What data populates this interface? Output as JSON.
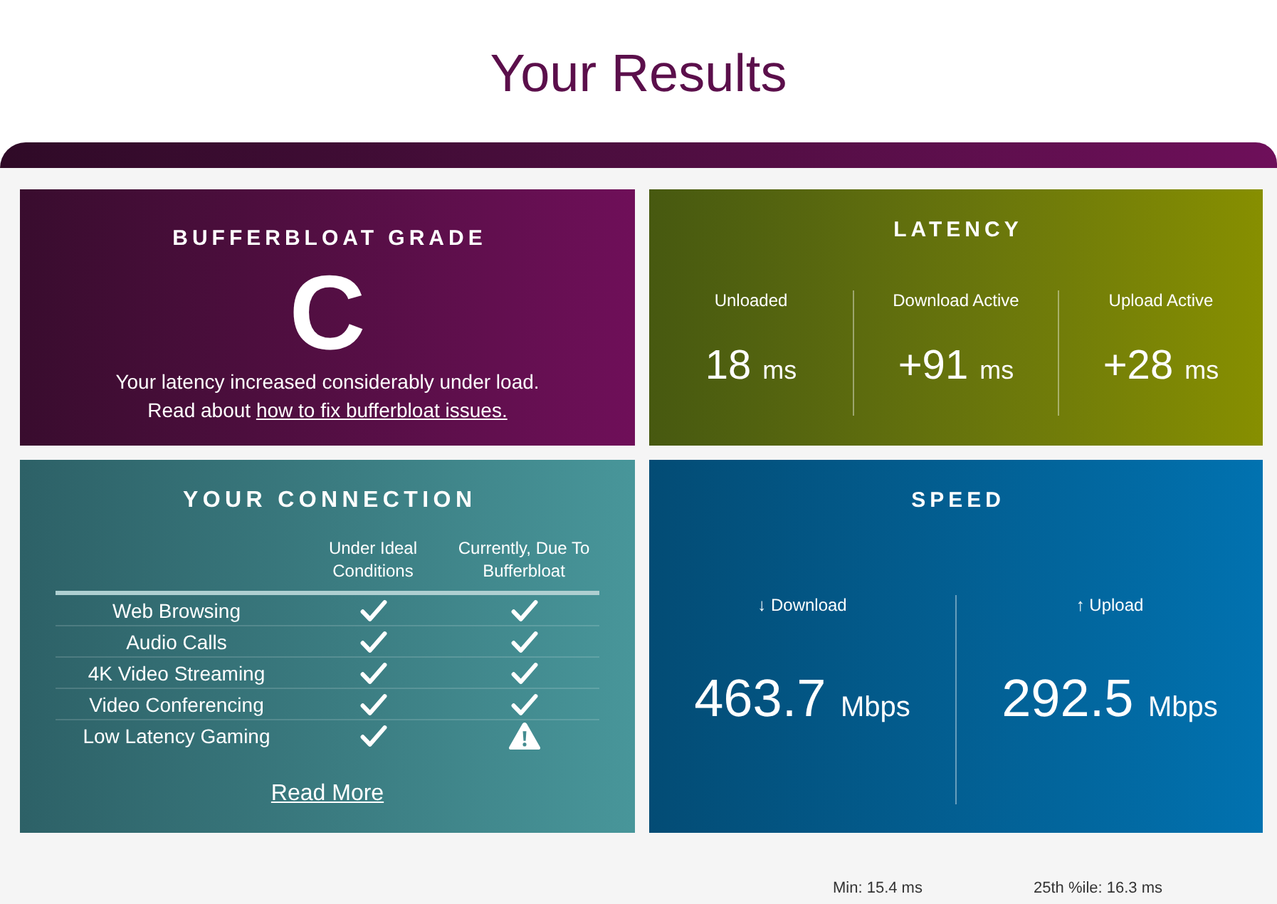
{
  "page": {
    "title": "Your Results"
  },
  "grade": {
    "title": "BUFFERBLOAT GRADE",
    "grade": "C",
    "description": "Your latency increased considerably under load.",
    "link_intro": "Read about",
    "link": "how to fix bufferbloat issues."
  },
  "latency": {
    "title": "LATENCY",
    "items": [
      {
        "label": "Unloaded",
        "value": "18",
        "unit": "ms"
      },
      {
        "label": "Download Active",
        "value": "+91",
        "unit": "ms"
      },
      {
        "label": "Upload Active",
        "value": "+28",
        "unit": "ms"
      }
    ]
  },
  "connection": {
    "title": "YOUR CONNECTION",
    "columns": [
      "Under Ideal Conditions",
      "Currently, Due To Bufferbloat"
    ],
    "rows": [
      {
        "name": "Web Browsing",
        "ideal_ok": true,
        "current_ok": true
      },
      {
        "name": "Audio Calls",
        "ideal_ok": true,
        "current_ok": true
      },
      {
        "name": "4K Video Streaming",
        "ideal_ok": true,
        "current_ok": true
      },
      {
        "name": "Video Conferencing",
        "ideal_ok": true,
        "current_ok": true
      },
      {
        "name": "Low Latency Gaming",
        "ideal_ok": true,
        "current_ok": false
      }
    ],
    "link": "Read More"
  },
  "speed": {
    "title": "SPEED",
    "items": [
      {
        "label": "↓ Download",
        "value": "463.7",
        "unit": "Mbps"
      },
      {
        "label": "↑ Upload",
        "value": "292.5",
        "unit": "Mbps"
      }
    ]
  },
  "latency_stats": [
    "Min: 15.4 ms",
    "25th %ile: 16.3 ms"
  ]
}
